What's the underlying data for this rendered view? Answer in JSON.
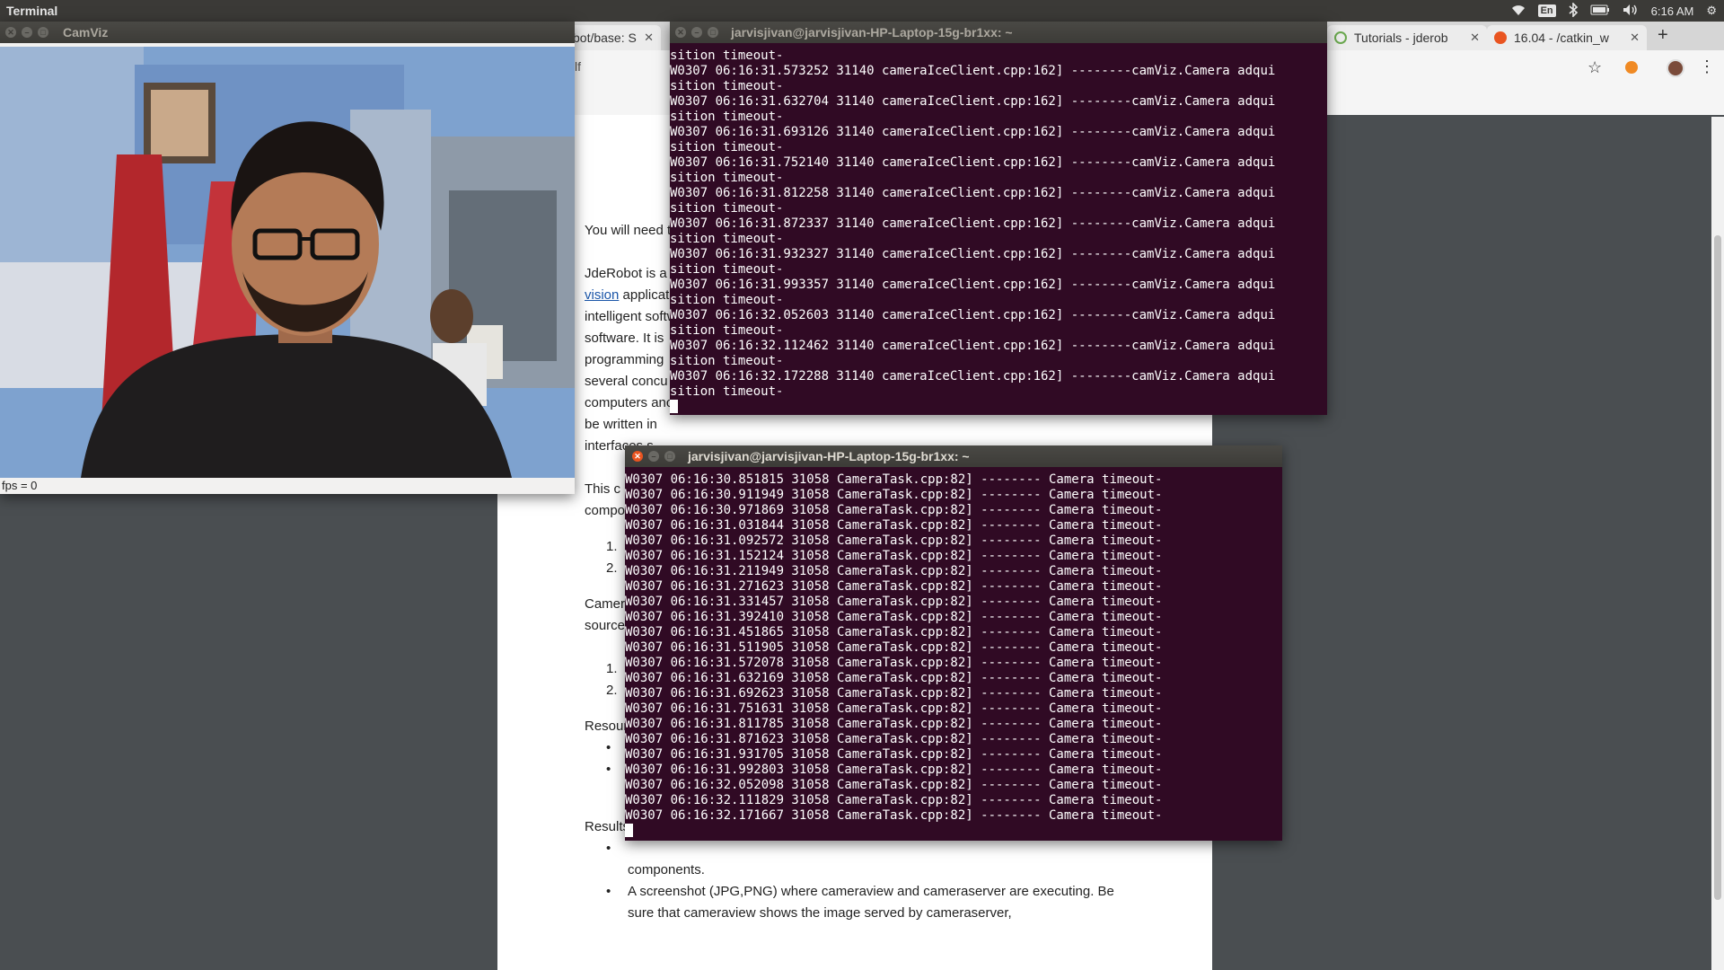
{
  "top_panel": {
    "app_title": "Terminal",
    "keyboard_layout": "En",
    "clock": "6:16 AM"
  },
  "browser": {
    "tabs": [
      {
        "label": "bot/base: S",
        "icon": "page-icon"
      },
      {
        "label": "Tutorials - jderob",
        "icon": "page-icon"
      },
      {
        "label": "16.04 - /catkin_w",
        "icon": "askubuntu-icon"
      }
    ],
    "address_text": "lf"
  },
  "document": {
    "p1": "You will need t",
    "p2": [
      "JdeRobot  is  a",
      "vision",
      "applicat",
      "intelligent softw",
      "software.  It is",
      "programming",
      "several  concu",
      "computers anc",
      "be  written  in",
      "interfaces.s"
    ],
    "p3": [
      "This  c",
      "compo"
    ],
    "list1": [
      "1.",
      "2."
    ],
    "p4": [
      "Camer",
      "source"
    ],
    "list2": [
      "1.",
      "2."
    ],
    "resources": "Resour",
    "results": "Results",
    "bullet_tail": "components.",
    "bullet2_line1": "A  screenshot  (JPG,PNG)  where  cameraview  and  cameraserver  are  executing.  Be",
    "bullet2_line2": "sure that cameraview shows the image served by cameraserver,"
  },
  "camviz": {
    "title": "CamViz",
    "fps_label": "fps = 0"
  },
  "terminal1": {
    "title": "jarvisjivan@jarvisjivan-HP-Laptop-15g-br1xx: ~",
    "lines": [
      "sition timeout-",
      "W0307 06:16:31.573252 31140 cameraIceClient.cpp:162] --------camViz.Camera adqui",
      "sition timeout-",
      "W0307 06:16:31.632704 31140 cameraIceClient.cpp:162] --------camViz.Camera adqui",
      "sition timeout-",
      "W0307 06:16:31.693126 31140 cameraIceClient.cpp:162] --------camViz.Camera adqui",
      "sition timeout-",
      "W0307 06:16:31.752140 31140 cameraIceClient.cpp:162] --------camViz.Camera adqui",
      "sition timeout-",
      "W0307 06:16:31.812258 31140 cameraIceClient.cpp:162] --------camViz.Camera adqui",
      "sition timeout-",
      "W0307 06:16:31.872337 31140 cameraIceClient.cpp:162] --------camViz.Camera adqui",
      "sition timeout-",
      "W0307 06:16:31.932327 31140 cameraIceClient.cpp:162] --------camViz.Camera adqui",
      "sition timeout-",
      "W0307 06:16:31.993357 31140 cameraIceClient.cpp:162] --------camViz.Camera adqui",
      "sition timeout-",
      "W0307 06:16:32.052603 31140 cameraIceClient.cpp:162] --------camViz.Camera adqui",
      "sition timeout-",
      "W0307 06:16:32.112462 31140 cameraIceClient.cpp:162] --------camViz.Camera adqui",
      "sition timeout-",
      "W0307 06:16:32.172288 31140 cameraIceClient.cpp:162] --------camViz.Camera adqui",
      "sition timeout-"
    ]
  },
  "terminal2": {
    "title": "jarvisjivan@jarvisjivan-HP-Laptop-15g-br1xx: ~",
    "lines": [
      "W0307 06:16:30.851815 31058 CameraTask.cpp:82] -------- Camera timeout-",
      "W0307 06:16:30.911949 31058 CameraTask.cpp:82] -------- Camera timeout-",
      "W0307 06:16:30.971869 31058 CameraTask.cpp:82] -------- Camera timeout-",
      "W0307 06:16:31.031844 31058 CameraTask.cpp:82] -------- Camera timeout-",
      "W0307 06:16:31.092572 31058 CameraTask.cpp:82] -------- Camera timeout-",
      "W0307 06:16:31.152124 31058 CameraTask.cpp:82] -------- Camera timeout-",
      "W0307 06:16:31.211949 31058 CameraTask.cpp:82] -------- Camera timeout-",
      "W0307 06:16:31.271623 31058 CameraTask.cpp:82] -------- Camera timeout-",
      "W0307 06:16:31.331457 31058 CameraTask.cpp:82] -------- Camera timeout-",
      "W0307 06:16:31.392410 31058 CameraTask.cpp:82] -------- Camera timeout-",
      "W0307 06:16:31.451865 31058 CameraTask.cpp:82] -------- Camera timeout-",
      "W0307 06:16:31.511905 31058 CameraTask.cpp:82] -------- Camera timeout-",
      "W0307 06:16:31.572078 31058 CameraTask.cpp:82] -------- Camera timeout-",
      "W0307 06:16:31.632169 31058 CameraTask.cpp:82] -------- Camera timeout-",
      "W0307 06:16:31.692623 31058 CameraTask.cpp:82] -------- Camera timeout-",
      "W0307 06:16:31.751631 31058 CameraTask.cpp:82] -------- Camera timeout-",
      "W0307 06:16:31.811785 31058 CameraTask.cpp:82] -------- Camera timeout-",
      "W0307 06:16:31.871623 31058 CameraTask.cpp:82] -------- Camera timeout-",
      "W0307 06:16:31.931705 31058 CameraTask.cpp:82] -------- Camera timeout-",
      "W0307 06:16:31.992803 31058 CameraTask.cpp:82] -------- Camera timeout-",
      "W0307 06:16:32.052098 31058 CameraTask.cpp:82] -------- Camera timeout-",
      "W0307 06:16:32.111829 31058 CameraTask.cpp:82] -------- Camera timeout-",
      "W0307 06:16:32.171667 31058 CameraTask.cpp:82] -------- Camera timeout-"
    ]
  },
  "colors": {
    "terminal_bg": "#300a24",
    "ubuntu_orange": "#e95420",
    "link": "#1a55a8"
  }
}
